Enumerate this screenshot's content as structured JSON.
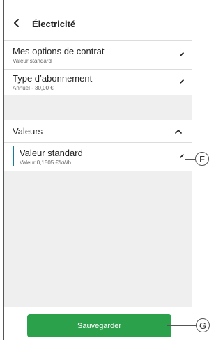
{
  "header": {
    "title": "Électricité"
  },
  "rows": [
    {
      "title": "Mes options de contrat",
      "subtitle": "Valeur standard"
    },
    {
      "title": "Type d’abonnement",
      "subtitle": "Annuel - 30,00 €"
    }
  ],
  "values_section": {
    "title": "Valeurs",
    "item": {
      "title": "Valeur standard",
      "subtitle": "Valeur 0,1505 €/kWh"
    }
  },
  "save_button": {
    "label": "Sauvegarder"
  },
  "callouts": {
    "f": "F",
    "g": "G"
  },
  "colors": {
    "accent": "#2aa14a",
    "indicator": "#1a7a9c"
  }
}
